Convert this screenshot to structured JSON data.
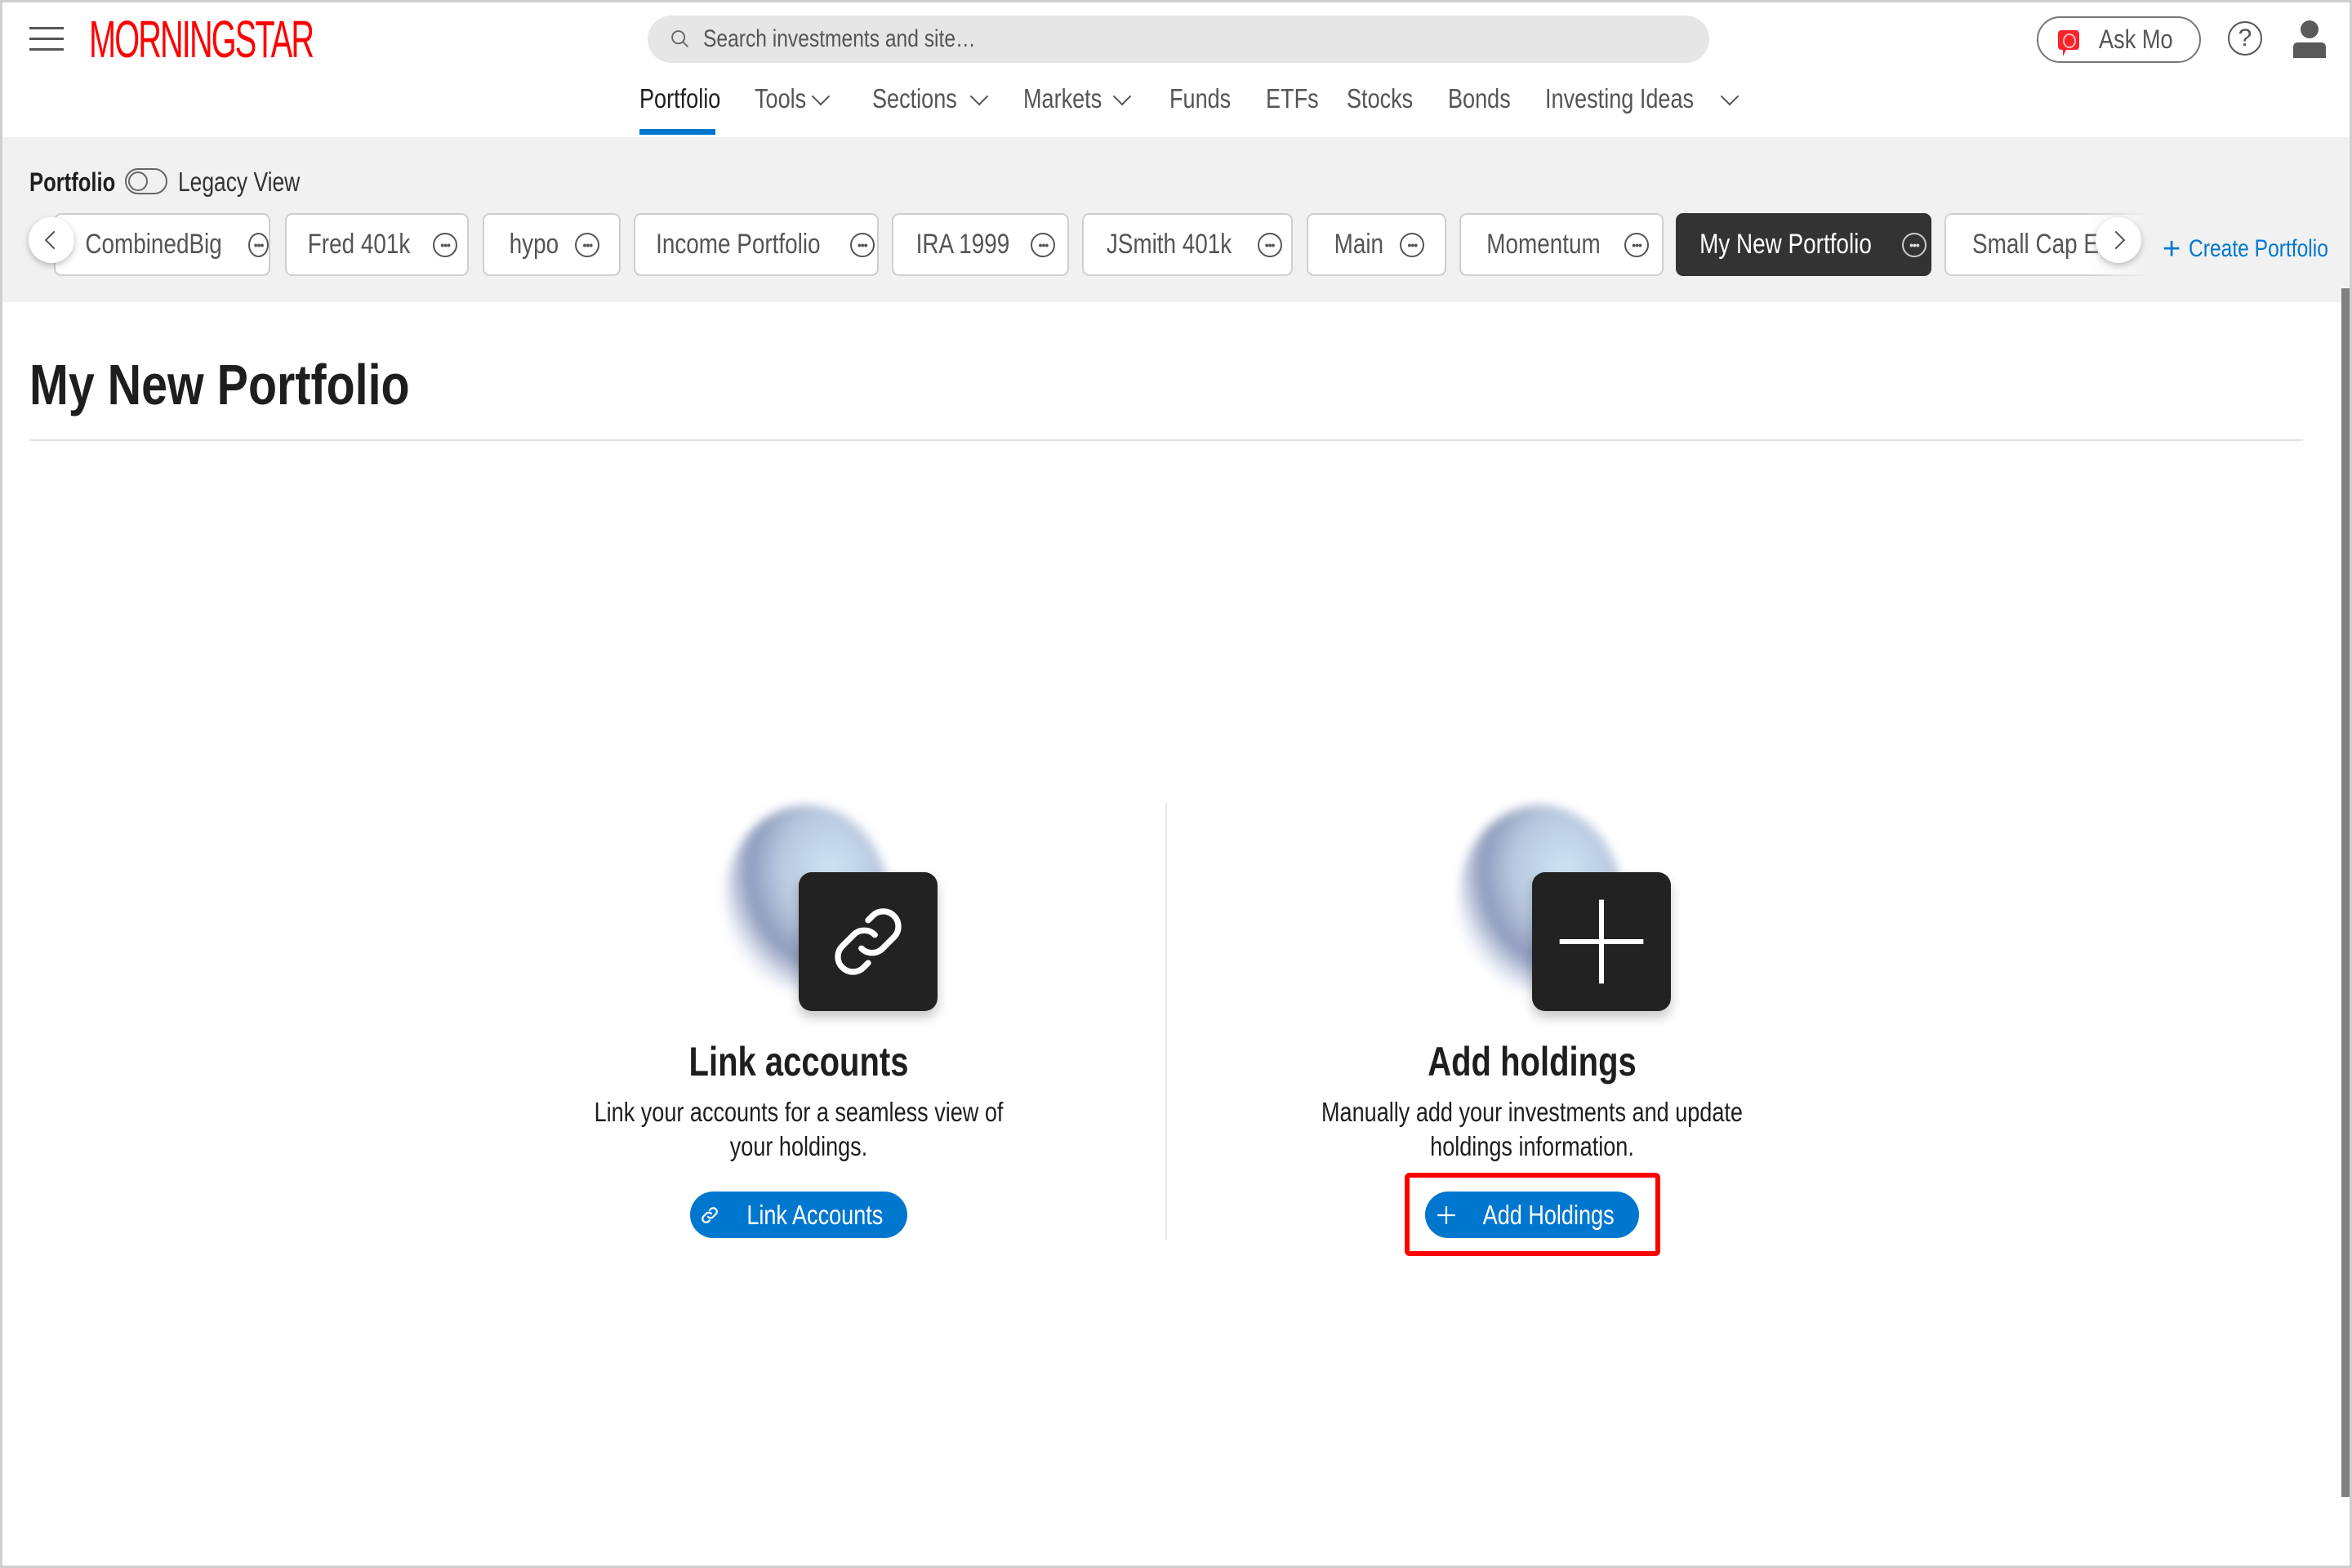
{
  "header": {
    "logo_text": "MORNINGSTAR",
    "brand_color": "#ff0000",
    "search": {
      "placeholder": "Search investments and site…",
      "value": ""
    },
    "ask_mo_label": "Ask Mo",
    "help_glyph": "?",
    "nav": [
      {
        "label": "Portfolio",
        "active": true,
        "has_dropdown": false
      },
      {
        "label": "Tools",
        "active": false,
        "has_dropdown": true
      },
      {
        "label": "Sections",
        "active": false,
        "has_dropdown": true
      },
      {
        "label": "Markets",
        "active": false,
        "has_dropdown": true
      },
      {
        "label": "Funds",
        "active": false,
        "has_dropdown": false
      },
      {
        "label": "ETFs",
        "active": false,
        "has_dropdown": false
      },
      {
        "label": "Stocks",
        "active": false,
        "has_dropdown": false
      },
      {
        "label": "Bonds",
        "active": false,
        "has_dropdown": false
      },
      {
        "label": "Investing Ideas",
        "active": false,
        "has_dropdown": true
      }
    ],
    "accent_color": "#0077cf"
  },
  "portfolio_bar": {
    "title": "Portfolio",
    "legacy_toggle": {
      "label": "Legacy View",
      "on": false
    },
    "portfolios": [
      {
        "name": "CombinedBig",
        "active": false
      },
      {
        "name": "Fred 401k",
        "active": false
      },
      {
        "name": "hypo",
        "active": false
      },
      {
        "name": "Income Portfolio",
        "active": false
      },
      {
        "name": "IRA 1999",
        "active": false
      },
      {
        "name": "JSmith 401k",
        "active": false
      },
      {
        "name": "Main",
        "active": false
      },
      {
        "name": "Momentum",
        "active": false
      },
      {
        "name": "My New Portfolio",
        "active": true
      },
      {
        "name": "Small Cap En",
        "active": false
      }
    ],
    "more_glyph": "•••",
    "create_label": "Create Portfolio",
    "create_glyph": "+"
  },
  "main": {
    "page_title": "My New Portfolio",
    "cards": [
      {
        "icon": "link-icon",
        "title": "Link accounts",
        "description": "Link your accounts for a seamless view of your holdings.",
        "button_label": "Link Accounts"
      },
      {
        "icon": "plus-icon",
        "title": "Add holdings",
        "description": "Manually add your investments and update holdings information.",
        "button_label": "Add Holdings",
        "highlighted": true
      }
    ],
    "button_color": "#0077cf",
    "highlight_color": "#ff0000"
  }
}
